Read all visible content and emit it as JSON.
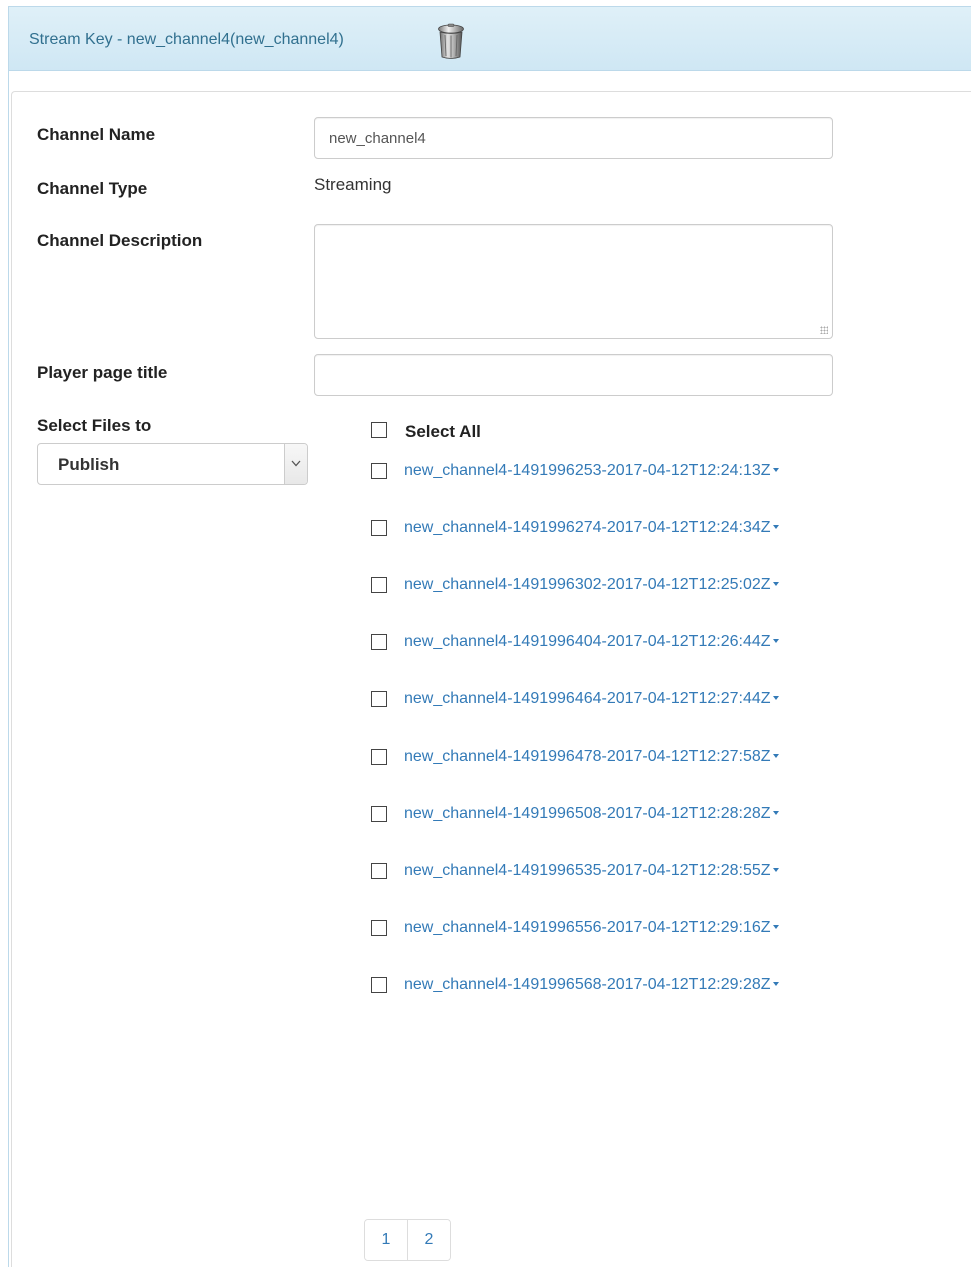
{
  "header": {
    "title": "Stream Key - new_channel4(new_channel4)",
    "delete_icon": "trash-icon"
  },
  "form": {
    "channel_name_label": "Channel Name",
    "channel_name_value": "new_channel4",
    "channel_type_label": "Channel Type",
    "channel_type_value": "Streaming",
    "channel_description_label": "Channel Description",
    "channel_description_value": "",
    "player_page_title_label": "Player page title",
    "player_page_title_value": "",
    "select_files_label": "Select Files to",
    "select_files_action": "Publish"
  },
  "files": {
    "select_all_label": "Select All",
    "items": [
      {
        "name": "new_channel4-1491996253-2017-04-12T12:24:13Z"
      },
      {
        "name": "new_channel4-1491996274-2017-04-12T12:24:34Z"
      },
      {
        "name": "new_channel4-1491996302-2017-04-12T12:25:02Z"
      },
      {
        "name": "new_channel4-1491996404-2017-04-12T12:26:44Z"
      },
      {
        "name": "new_channel4-1491996464-2017-04-12T12:27:44Z"
      },
      {
        "name": "new_channel4-1491996478-2017-04-12T12:27:58Z"
      },
      {
        "name": "new_channel4-1491996508-2017-04-12T12:28:28Z"
      },
      {
        "name": "new_channel4-1491996535-2017-04-12T12:28:55Z"
      },
      {
        "name": "new_channel4-1491996556-2017-04-12T12:29:16Z"
      },
      {
        "name": "new_channel4-1491996568-2017-04-12T12:29:28Z"
      }
    ]
  },
  "pagination": {
    "pages": [
      "1",
      "2"
    ]
  },
  "colors": {
    "header_bg": "#d9edf7",
    "header_text": "#31708f",
    "link": "#337ab7"
  }
}
